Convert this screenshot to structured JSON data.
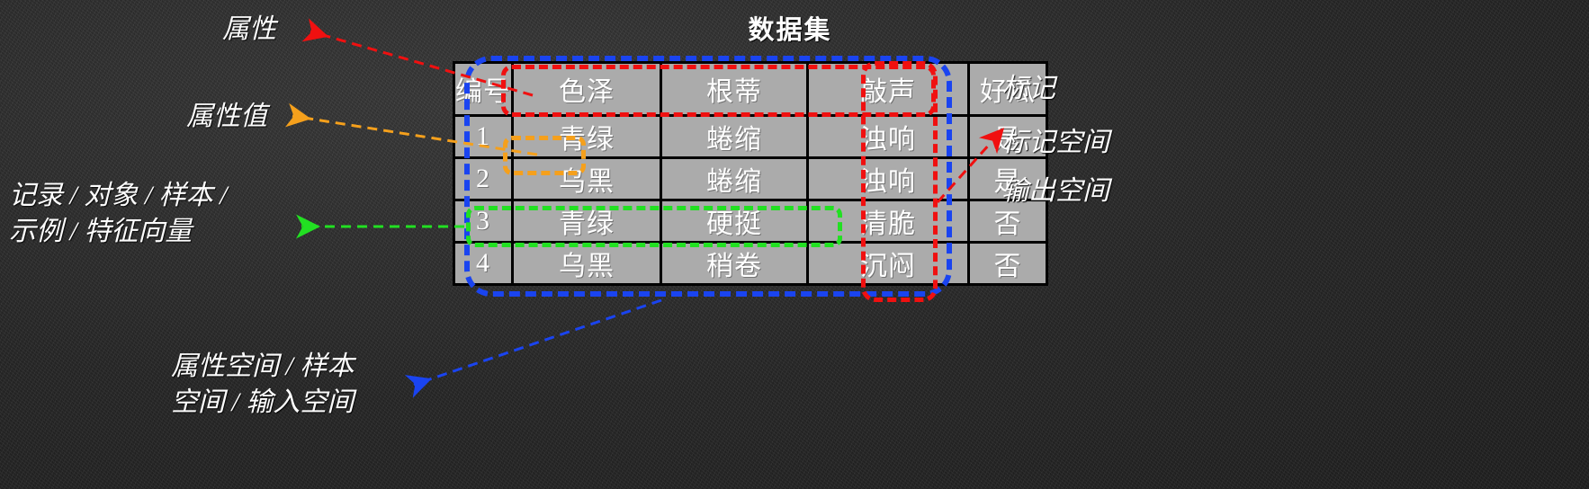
{
  "title": "数据集",
  "table": {
    "headers": [
      "编号",
      "色泽",
      "根蒂",
      "敲声",
      "好瓜"
    ],
    "rows": [
      [
        "1",
        "青绿",
        "蜷缩",
        "浊响",
        "是"
      ],
      [
        "2",
        "乌黑",
        "蜷缩",
        "浊响",
        "是"
      ],
      [
        "3",
        "青绿",
        "硬挺",
        "清脆",
        "否"
      ],
      [
        "4",
        "乌黑",
        "稍卷",
        "沉闷",
        "否"
      ]
    ]
  },
  "annotations": {
    "attribute": "属性",
    "attribute_value": "属性值",
    "record": "记录 / 对象 / 样本 /\n示例 / 特征向量",
    "attribute_space": "属性空间 / 样本\n空间 / 输入空间",
    "label": "标记",
    "label_space": "标记空间",
    "output_space": "输出空间"
  },
  "colors": {
    "red": "#f01010",
    "orange": "#f5a01c",
    "green": "#22e022",
    "blue": "#1a44f0",
    "cell_bg": "#ababab",
    "text": "#ffffff",
    "background": "#2d2d2d"
  }
}
